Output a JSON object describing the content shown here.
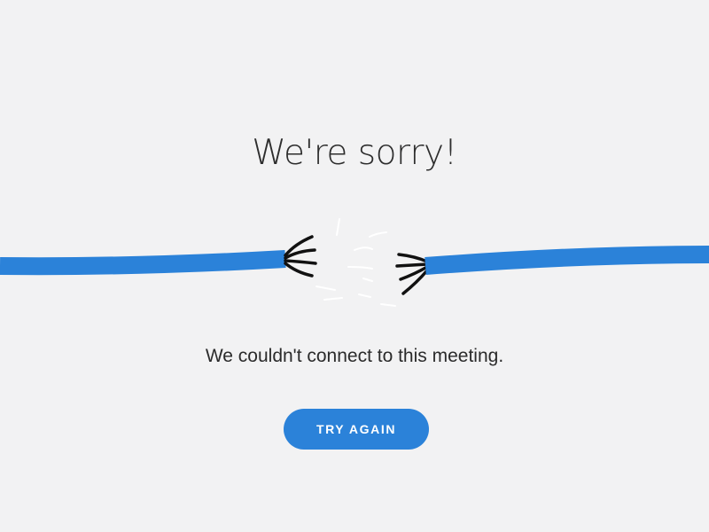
{
  "error": {
    "title": "We're sorry!",
    "message": "We couldn't connect to this meeting.",
    "retry_label": "TRY AGAIN"
  },
  "illustration": {
    "icon": "broken-cable-icon",
    "cable_color": "#2b82d9",
    "wire_color": "#111111",
    "spark_color": "#ffffff"
  },
  "colors": {
    "background": "#f2f2f3",
    "accent": "#2b82d9",
    "text": "#2d2d2d"
  }
}
